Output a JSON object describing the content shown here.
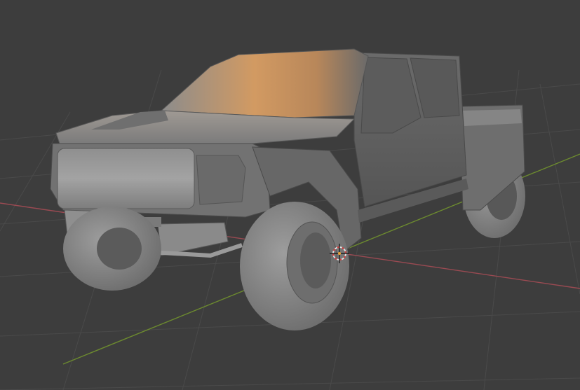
{
  "viewport": {
    "background": "#3d3d3d",
    "grid_color": "#4a4a4a",
    "x_axis_color": "#9a4a52",
    "y_axis_color": "#6c8a2f",
    "model_base": "#7a7a7a",
    "highlight": "#c99a6a"
  },
  "scene": {
    "object": "pickup-truck-model",
    "shading": "solid",
    "has_3d_cursor": true
  }
}
